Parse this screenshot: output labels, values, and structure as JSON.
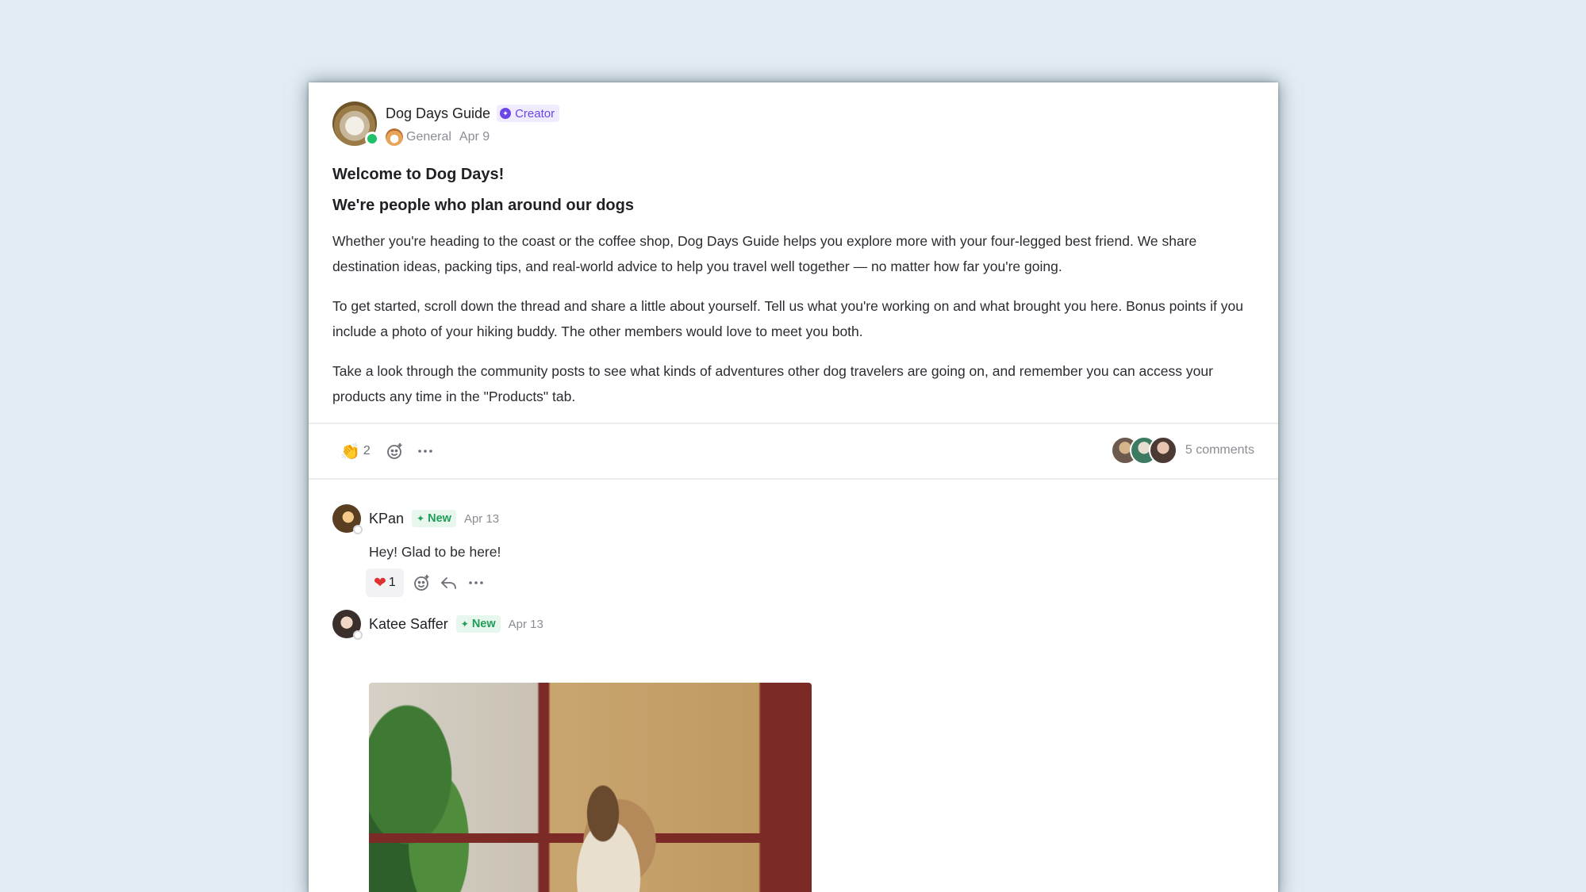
{
  "post": {
    "author": "Dog Days Guide",
    "author_badge": "Creator",
    "space": "General",
    "date": "Apr 9",
    "title": "Welcome to Dog Days!",
    "subtitle": "We're people who plan around our dogs",
    "paragraphs": [
      "Whether you're heading to the coast or the coffee shop, Dog Days Guide helps you explore more with your four-legged best friend. We share destination ideas, packing tips, and real-world advice to help you travel well together — no matter how far you're going.",
      "To get started, scroll down the thread and share a little about yourself. Tell us what you're working on and what brought you here. Bonus points if you include a photo of your hiking buddy. The other members would love to meet you both.",
      "Take a look through the community posts to see what kinds of adventures other dog travelers are going on, and remember you can access your products any time in the \"Products\" tab."
    ],
    "reaction_count": "2",
    "comments_count_label": "5 comments"
  },
  "comments": [
    {
      "name": "KPan",
      "badge": "New",
      "date": "Apr 13",
      "text": "Hey! Glad to be here!",
      "reaction_count": "1"
    },
    {
      "name": "Katee Saffer",
      "badge": "New",
      "date": "Apr 13"
    }
  ],
  "colors": {
    "background": "#e2ecf2",
    "creator_accent": "#6b46e5",
    "new_badge_accent": "#1f9d57",
    "online_status": "#1fc16b",
    "heart": "#e03131"
  }
}
